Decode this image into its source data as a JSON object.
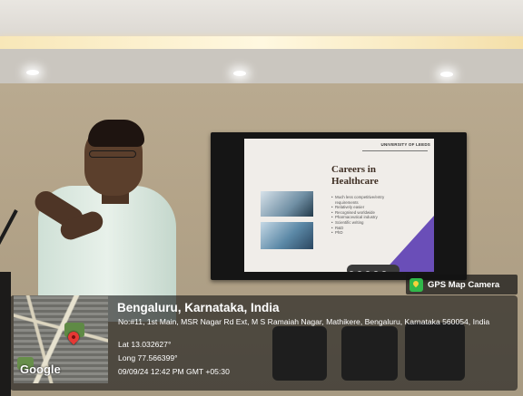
{
  "slide": {
    "brand": "UNIVERSITY OF LEEDS",
    "title": "Careers in Healthcare",
    "bullets": [
      "Much less competitive/entry requirements",
      "Relatively easier",
      "Recognised worldwide",
      "Pharmaceutical industry",
      "Scientific writing",
      "R&D",
      "PhD"
    ]
  },
  "gps": {
    "badge_label": "GPS Map Camera",
    "place": "Bengaluru, Karnataka, India",
    "address": "No:#11, 1st Main, MSR Nagar Rd Ext, M S Ramaiah Nagar, Mathikere, Bengaluru, Karnataka 560054, India",
    "lat": "Lat 13.032627°",
    "long": "Long 77.566399°",
    "datetime": "09/09/24 12:42 PM GMT +05:30",
    "map_logo": "Google"
  },
  "icons": [
    "gps-map-camera-icon",
    "map-pin-icon"
  ],
  "colors": {
    "badge_icon": "#30b84a",
    "pin": "#e53935",
    "slide_accent": "#6a4eb8"
  }
}
